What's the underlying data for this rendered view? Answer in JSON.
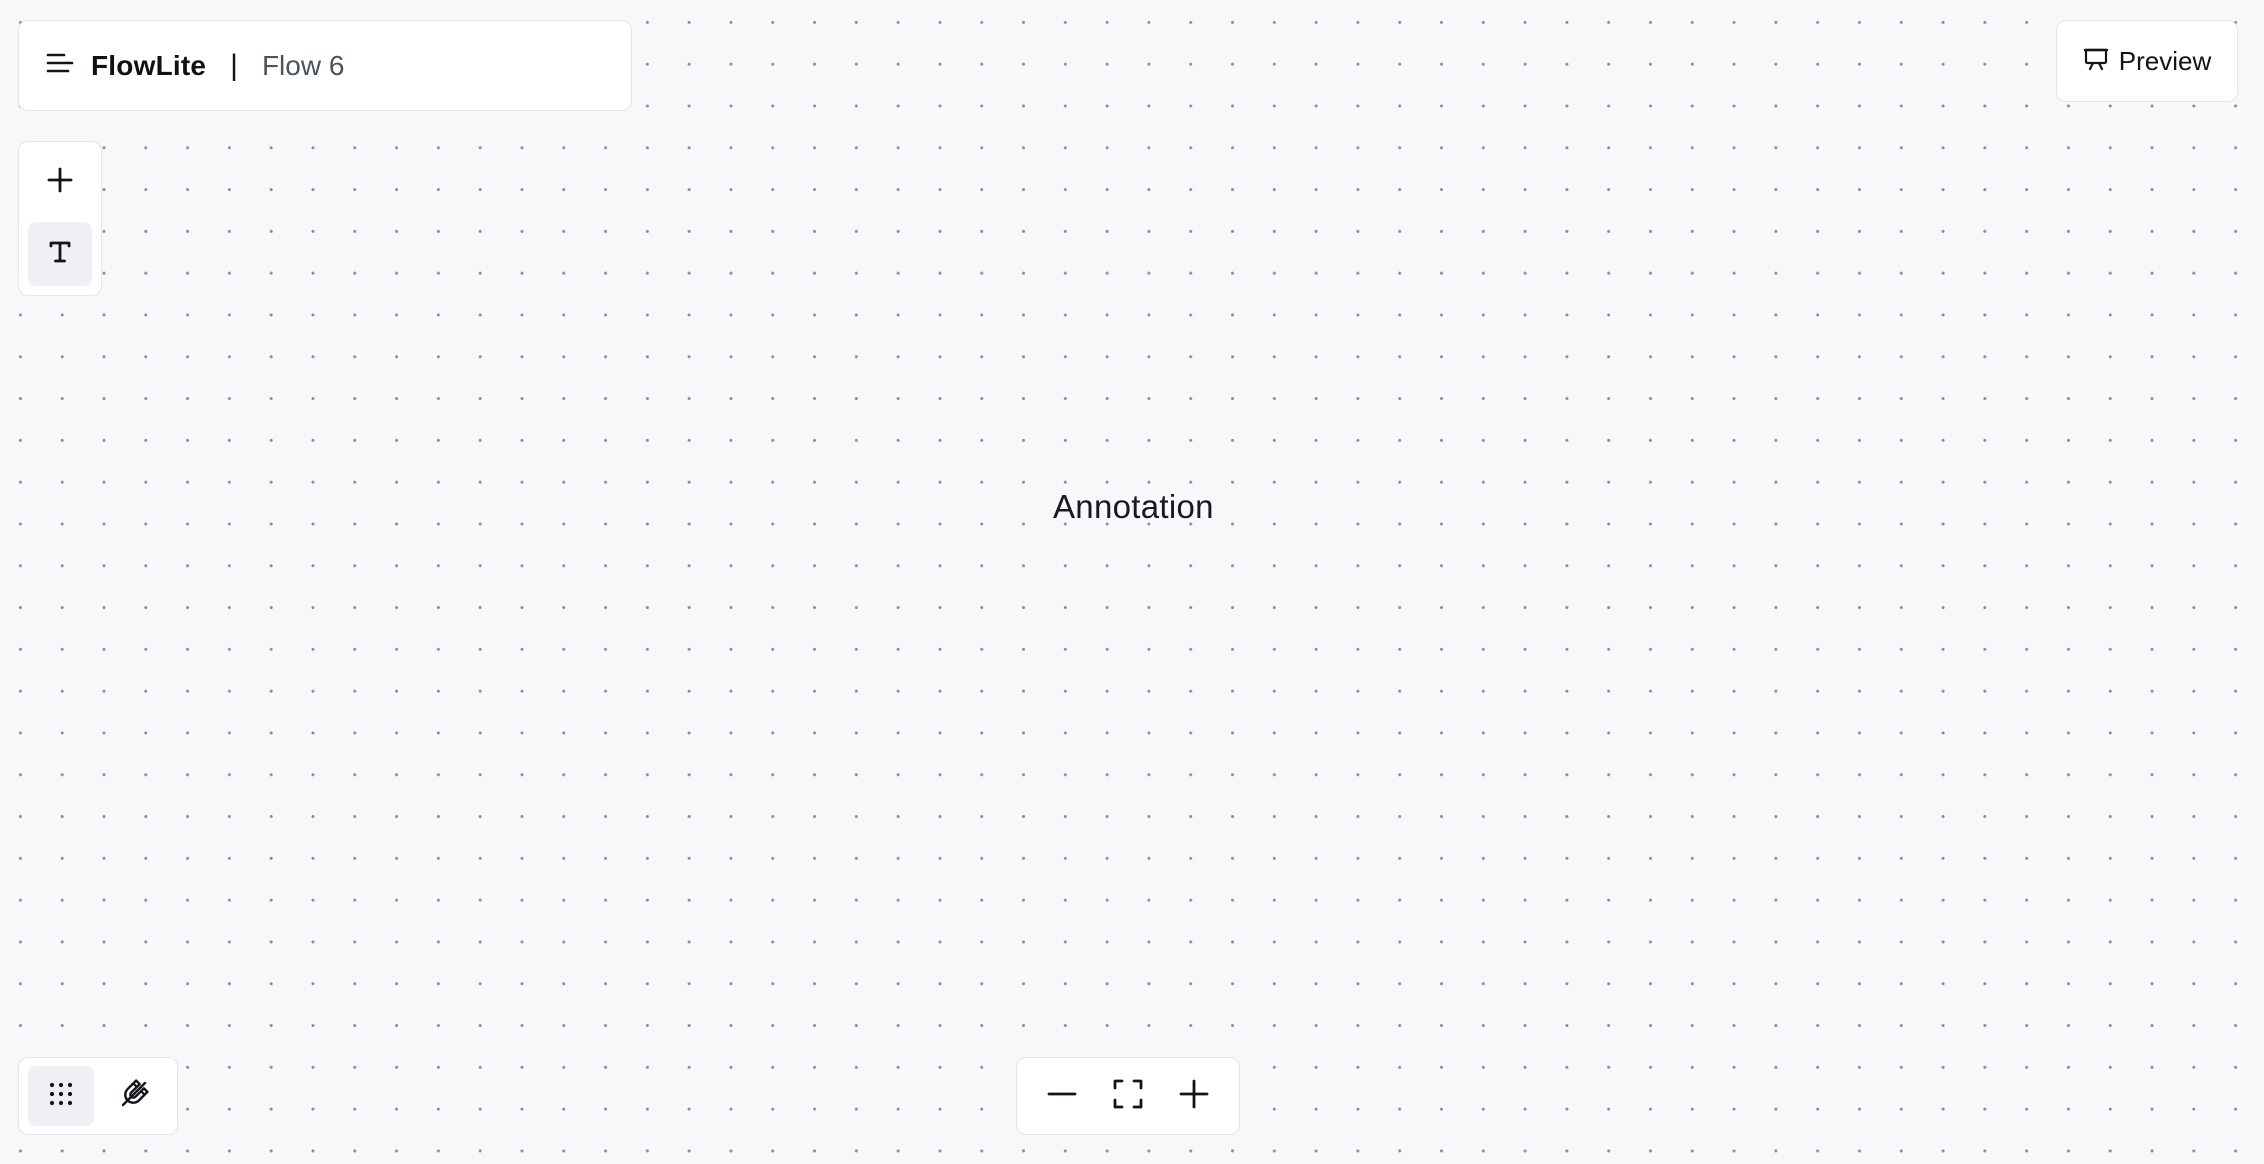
{
  "app": {
    "name": "FlowLite",
    "separator": "|",
    "flow_name": "Flow 6"
  },
  "header": {
    "preview_label": "Preview",
    "menu_icon": "menu-icon",
    "preview_icon": "presentation-icon"
  },
  "toolbar": {
    "tools": [
      {
        "icon": "plus-icon",
        "action": "add-node"
      },
      {
        "icon": "text-icon",
        "action": "text-tool",
        "active": true
      }
    ]
  },
  "canvas": {
    "background": "dotted-grid",
    "annotation_text": "Annotation"
  },
  "canvas_options": {
    "grid": {
      "icon": "grid-dots-icon",
      "active": true
    },
    "snap": {
      "icon": "magnet-icon",
      "active": false
    }
  },
  "zoom": {
    "zoom_out_icon": "minus-icon",
    "fit_icon": "fit-view-icon",
    "zoom_in_icon": "plus-icon"
  },
  "colors": {
    "canvas_bg": "#f7f8fa",
    "panel_bg": "#ffffff",
    "panel_border": "#e3e6ea",
    "active_tool_bg": "#eef0f3",
    "secondary_text": "#4a5361"
  }
}
